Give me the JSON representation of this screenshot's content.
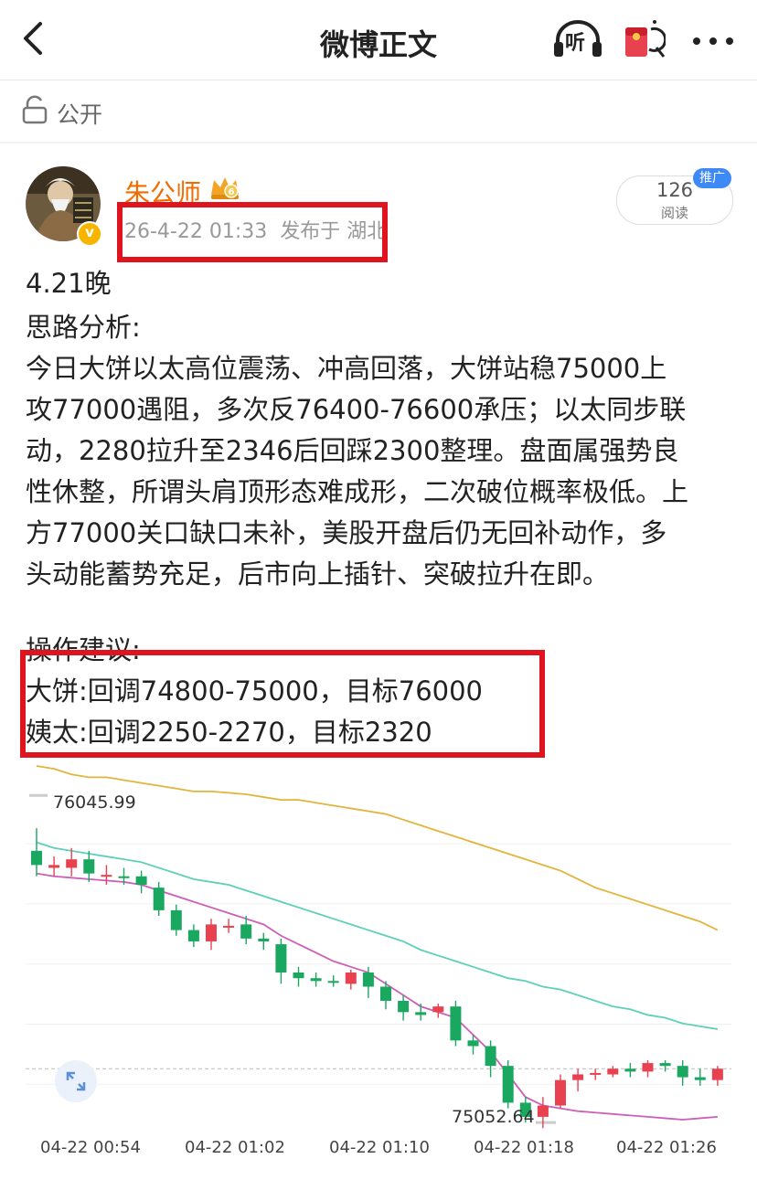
{
  "nav": {
    "title": "微博正文",
    "listen_label": "听",
    "back_icon": "back-arrow-icon",
    "more_icon": "more-dots-icon"
  },
  "visibility": {
    "label": "公开",
    "icon": "unlock-icon"
  },
  "post": {
    "username": "朱公师",
    "timestamp": "26-4-22 01:33",
    "location": "发布于 湖北",
    "reads_count": "126",
    "reads_label": "阅读",
    "promo_badge": "推广",
    "lines": [
      "4.21晚",
      "思路分析:",
      "今日大饼以太高位震荡、冲高回落，大饼站稳75000上",
      "攻77000遇阻，多次反76400-76600承压；以太同步联",
      "动，2280拉升至2346后回踩2300整理。盘面属强势良",
      "性休整，所谓头肩顶形态难成形，二次破位概率极低。上",
      "方77000关口缺口未补，美股开盘后仍无回补动作，多",
      "头动能蓄势充足，后市向上插针、突破拉升在即。",
      "",
      "操作建议:",
      "大饼:回调74800-75000，目标76000",
      "姨太:回调2250-2270，目标2320"
    ]
  },
  "colors": {
    "up": "#e8414f",
    "down": "#1aa760",
    "accent": "#f06c00",
    "redbox": "#e0141e",
    "ma_yellow": "#e3b43d",
    "ma_teal": "#5ecfb8",
    "ma_pink": "#cc5fb8"
  },
  "chart_data": {
    "type": "candlestick",
    "high_label": "76045.99",
    "low_label": "75052.64",
    "x_ticks": [
      "04-22 00:54",
      "04-22 01:02",
      "04-22 01:10",
      "04-22 01:18",
      "04-22 01:26"
    ],
    "ylim": [
      74900,
      76150
    ],
    "candles": [
      {
        "o": 75850,
        "c": 75800,
        "h": 75930,
        "l": 75760
      },
      {
        "o": 75790,
        "c": 75800,
        "h": 75830,
        "l": 75760
      },
      {
        "o": 75790,
        "c": 75820,
        "h": 75860,
        "l": 75760
      },
      {
        "o": 75820,
        "c": 75770,
        "h": 75850,
        "l": 75740
      },
      {
        "o": 75760,
        "c": 75765,
        "h": 75800,
        "l": 75730
      },
      {
        "o": 75760,
        "c": 75755,
        "h": 75790,
        "l": 75730
      },
      {
        "o": 75760,
        "c": 75730,
        "h": 75780,
        "l": 75700
      },
      {
        "o": 75720,
        "c": 75640,
        "h": 75740,
        "l": 75620
      },
      {
        "o": 75640,
        "c": 75570,
        "h": 75660,
        "l": 75550
      },
      {
        "o": 75570,
        "c": 75530,
        "h": 75590,
        "l": 75510
      },
      {
        "o": 75530,
        "c": 75590,
        "h": 75610,
        "l": 75500
      },
      {
        "o": 75580,
        "c": 75585,
        "h": 75610,
        "l": 75560
      },
      {
        "o": 75590,
        "c": 75540,
        "h": 75620,
        "l": 75520
      },
      {
        "o": 75540,
        "c": 75530,
        "h": 75560,
        "l": 75500
      },
      {
        "o": 75520,
        "c": 75420,
        "h": 75540,
        "l": 75380
      },
      {
        "o": 75420,
        "c": 75400,
        "h": 75440,
        "l": 75370
      },
      {
        "o": 75400,
        "c": 75390,
        "h": 75420,
        "l": 75370
      },
      {
        "o": 75390,
        "c": 75385,
        "h": 75410,
        "l": 75370
      },
      {
        "o": 75380,
        "c": 75420,
        "h": 75430,
        "l": 75360
      },
      {
        "o": 75420,
        "c": 75370,
        "h": 75440,
        "l": 75330
      },
      {
        "o": 75370,
        "c": 75320,
        "h": 75390,
        "l": 75290
      },
      {
        "o": 75320,
        "c": 75280,
        "h": 75340,
        "l": 75250
      },
      {
        "o": 75280,
        "c": 75270,
        "h": 75310,
        "l": 75250
      },
      {
        "o": 75280,
        "c": 75300,
        "h": 75310,
        "l": 75260
      },
      {
        "o": 75300,
        "c": 75180,
        "h": 75320,
        "l": 75160
      },
      {
        "o": 75180,
        "c": 75160,
        "h": 75200,
        "l": 75130
      },
      {
        "o": 75160,
        "c": 75090,
        "h": 75180,
        "l": 75050
      },
      {
        "o": 75090,
        "c": 74960,
        "h": 75110,
        "l": 74940
      },
      {
        "o": 74960,
        "c": 74910,
        "h": 74980,
        "l": 74890
      },
      {
        "o": 74910,
        "c": 74950,
        "h": 74980,
        "l": 74870
      },
      {
        "o": 74950,
        "c": 75040,
        "h": 75060,
        "l": 74940
      },
      {
        "o": 75040,
        "c": 75060,
        "h": 75080,
        "l": 75000
      },
      {
        "o": 75060,
        "c": 75065,
        "h": 75080,
        "l": 75040
      },
      {
        "o": 75060,
        "c": 75080,
        "h": 75090,
        "l": 75050
      },
      {
        "o": 75080,
        "c": 75070,
        "h": 75100,
        "l": 75050
      },
      {
        "o": 75070,
        "c": 75100,
        "h": 75110,
        "l": 75050
      },
      {
        "o": 75100,
        "c": 75090,
        "h": 75110,
        "l": 75070
      },
      {
        "o": 75090,
        "c": 75050,
        "h": 75110,
        "l": 75020
      },
      {
        "o": 75050,
        "c": 75040,
        "h": 75080,
        "l": 75020
      },
      {
        "o": 75040,
        "c": 75080,
        "h": 75090,
        "l": 75020
      }
    ],
    "ma_yellow": [
      76150,
      76140,
      76120,
      76110,
      76110,
      76100,
      76090,
      76080,
      76070,
      76060,
      76060,
      76055,
      76050,
      76040,
      76030,
      76030,
      76020,
      76010,
      76000,
      75990,
      75980,
      75960,
      75940,
      75920,
      75900,
      75880,
      75860,
      75840,
      75820,
      75800,
      75780,
      75750,
      75720,
      75700,
      75680,
      75660,
      75640,
      75620,
      75600,
      75570
    ],
    "ma_teal": [
      75880,
      75860,
      75850,
      75840,
      75830,
      75820,
      75810,
      75790,
      75770,
      75750,
      75740,
      75730,
      75710,
      75690,
      75670,
      75650,
      75630,
      75610,
      75590,
      75570,
      75550,
      75530,
      75500,
      75480,
      75460,
      75440,
      75420,
      75400,
      75390,
      75370,
      75360,
      75340,
      75320,
      75300,
      75290,
      75270,
      75260,
      75240,
      75230,
      75220
    ],
    "ma_pink": [
      75770,
      75760,
      75755,
      75750,
      75745,
      75740,
      75730,
      75710,
      75690,
      75670,
      75650,
      75630,
      75610,
      75590,
      75550,
      75520,
      75490,
      75460,
      75440,
      75420,
      75380,
      75340,
      75300,
      75280,
      75260,
      75200,
      75140,
      75060,
      74980,
      74950,
      74940,
      74930,
      74925,
      74920,
      74915,
      74910,
      74905,
      74900,
      74905,
      74910
    ]
  }
}
